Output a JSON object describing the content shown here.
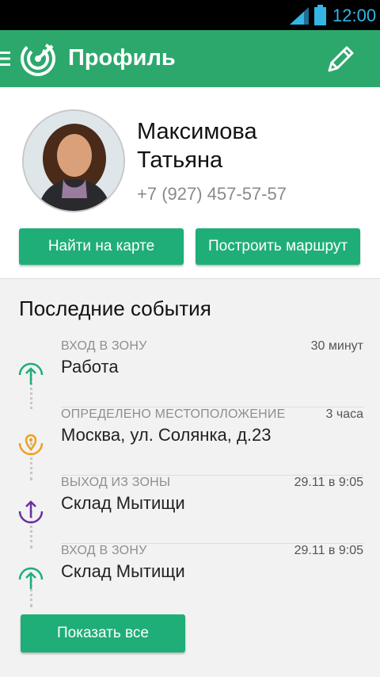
{
  "status_bar": {
    "time": "12:00",
    "icons": [
      "signal-icon",
      "battery-icon"
    ]
  },
  "app_bar": {
    "title": "Профиль",
    "icons": [
      "menu-icon",
      "radar-logo-icon",
      "edit-pencil-icon"
    ]
  },
  "profile": {
    "first_line": "Максимова",
    "second_line": "Татьяна",
    "phone": "+7 (927) 457-57-57",
    "btn_map": "Найти на карте",
    "btn_route": "Построить маршрут"
  },
  "events": {
    "title": "Последние события",
    "items": [
      {
        "type": "ВХОД В ЗОНУ",
        "time": "30 минут",
        "place": "Работа",
        "icon": "zone-enter-icon",
        "color": "#1fae78"
      },
      {
        "type": "ОПРЕДЕЛЕНО МЕСТОПОЛОЖЕНИЕ",
        "time": "3 часа",
        "place": "Москва, ул. Солянка, д.23",
        "icon": "location-pin-icon",
        "color": "#f0a020"
      },
      {
        "type": "ВЫХОД ИЗ ЗОНЫ",
        "time": "29.11 в 9:05",
        "place": "Склад Мытищи",
        "icon": "zone-exit-icon",
        "color": "#6a2fa0"
      },
      {
        "type": "ВХОД В ЗОНУ",
        "time": "29.11 в 9:05",
        "place": "Склад Мытищи",
        "icon": "zone-enter-icon",
        "color": "#1fae78"
      }
    ],
    "show_all": "Показать все"
  },
  "colors": {
    "primary": "#2da86d",
    "button": "#1fae78",
    "status_time": "#33b5e5"
  }
}
